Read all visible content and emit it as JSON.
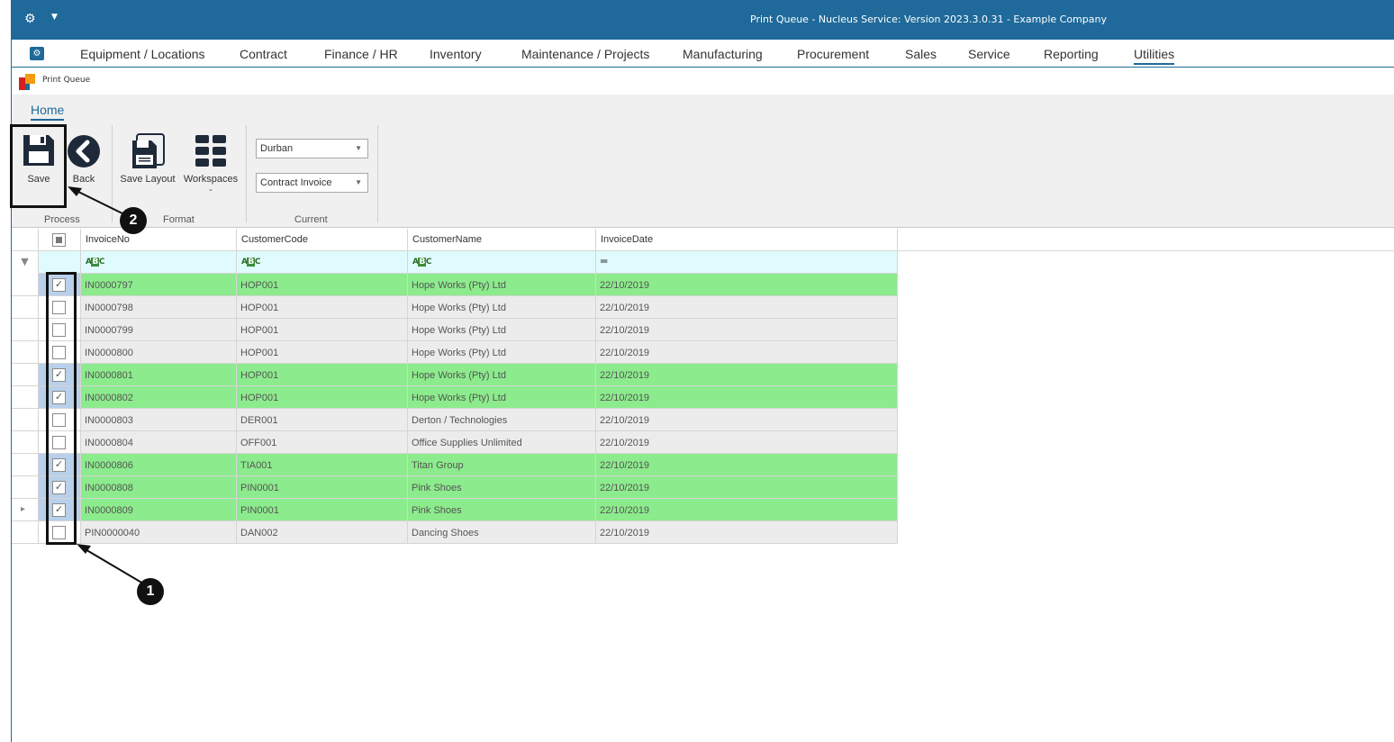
{
  "window": {
    "title": "Print Queue - Nucleus Service: Version 2023.3.0.31 - Example Company"
  },
  "menu": {
    "items": [
      "Equipment / Locations",
      "Contract",
      "Finance / HR",
      "Inventory",
      "Maintenance / Projects",
      "Manufacturing",
      "Procurement",
      "Sales",
      "Service",
      "Reporting",
      "Utilities"
    ],
    "active": "Utilities"
  },
  "document": {
    "title": "Print Queue"
  },
  "ribbon": {
    "tab": "Home",
    "save_label": "Save",
    "back_label": "Back",
    "save_layout_label": "Save Layout",
    "workspaces_label": "Workspaces",
    "group_process": "Process",
    "group_format": "Format",
    "group_current": "Current",
    "combo_site": "Durban",
    "combo_type": "Contract Invoice"
  },
  "grid": {
    "columns": [
      "InvoiceNo",
      "CustomerCode",
      "CustomerName",
      "InvoiceDate"
    ],
    "rows": [
      {
        "checked": true,
        "invoice": "IN0000797",
        "code": "HOP001",
        "name": "Hope Works (Pty) Ltd",
        "date": "22/10/2019"
      },
      {
        "checked": false,
        "invoice": "IN0000798",
        "code": "HOP001",
        "name": "Hope Works (Pty) Ltd",
        "date": "22/10/2019"
      },
      {
        "checked": false,
        "invoice": "IN0000799",
        "code": "HOP001",
        "name": "Hope Works (Pty) Ltd",
        "date": "22/10/2019"
      },
      {
        "checked": false,
        "invoice": "IN0000800",
        "code": "HOP001",
        "name": "Hope Works (Pty) Ltd",
        "date": "22/10/2019"
      },
      {
        "checked": true,
        "invoice": "IN0000801",
        "code": "HOP001",
        "name": "Hope Works (Pty) Ltd",
        "date": "22/10/2019"
      },
      {
        "checked": true,
        "invoice": "IN0000802",
        "code": "HOP001",
        "name": "Hope Works (Pty) Ltd",
        "date": "22/10/2019"
      },
      {
        "checked": false,
        "invoice": "IN0000803",
        "code": "DER001",
        "name": "Derton / Technologies",
        "date": "22/10/2019"
      },
      {
        "checked": false,
        "invoice": "IN0000804",
        "code": "OFF001",
        "name": "Office Supplies Unlimited",
        "date": "22/10/2019"
      },
      {
        "checked": true,
        "invoice": "IN0000806",
        "code": "TIA001",
        "name": "Titan Group",
        "date": "22/10/2019"
      },
      {
        "checked": true,
        "invoice": "IN0000808",
        "code": "PIN0001",
        "name": "Pink Shoes",
        "date": "22/10/2019"
      },
      {
        "checked": true,
        "invoice": "IN0000809",
        "code": "PIN0001",
        "name": "Pink Shoes",
        "date": "22/10/2019",
        "current": true
      },
      {
        "checked": false,
        "invoice": "PIN0000040",
        "code": "DAN002",
        "name": "Dancing Shoes",
        "date": "22/10/2019"
      }
    ]
  },
  "annotations": {
    "badge1": "1",
    "badge2": "2"
  },
  "colors": {
    "accent": "#1f6a9a",
    "selected_row": "#8ceb8c",
    "filter_row": "#e0fbfd"
  }
}
